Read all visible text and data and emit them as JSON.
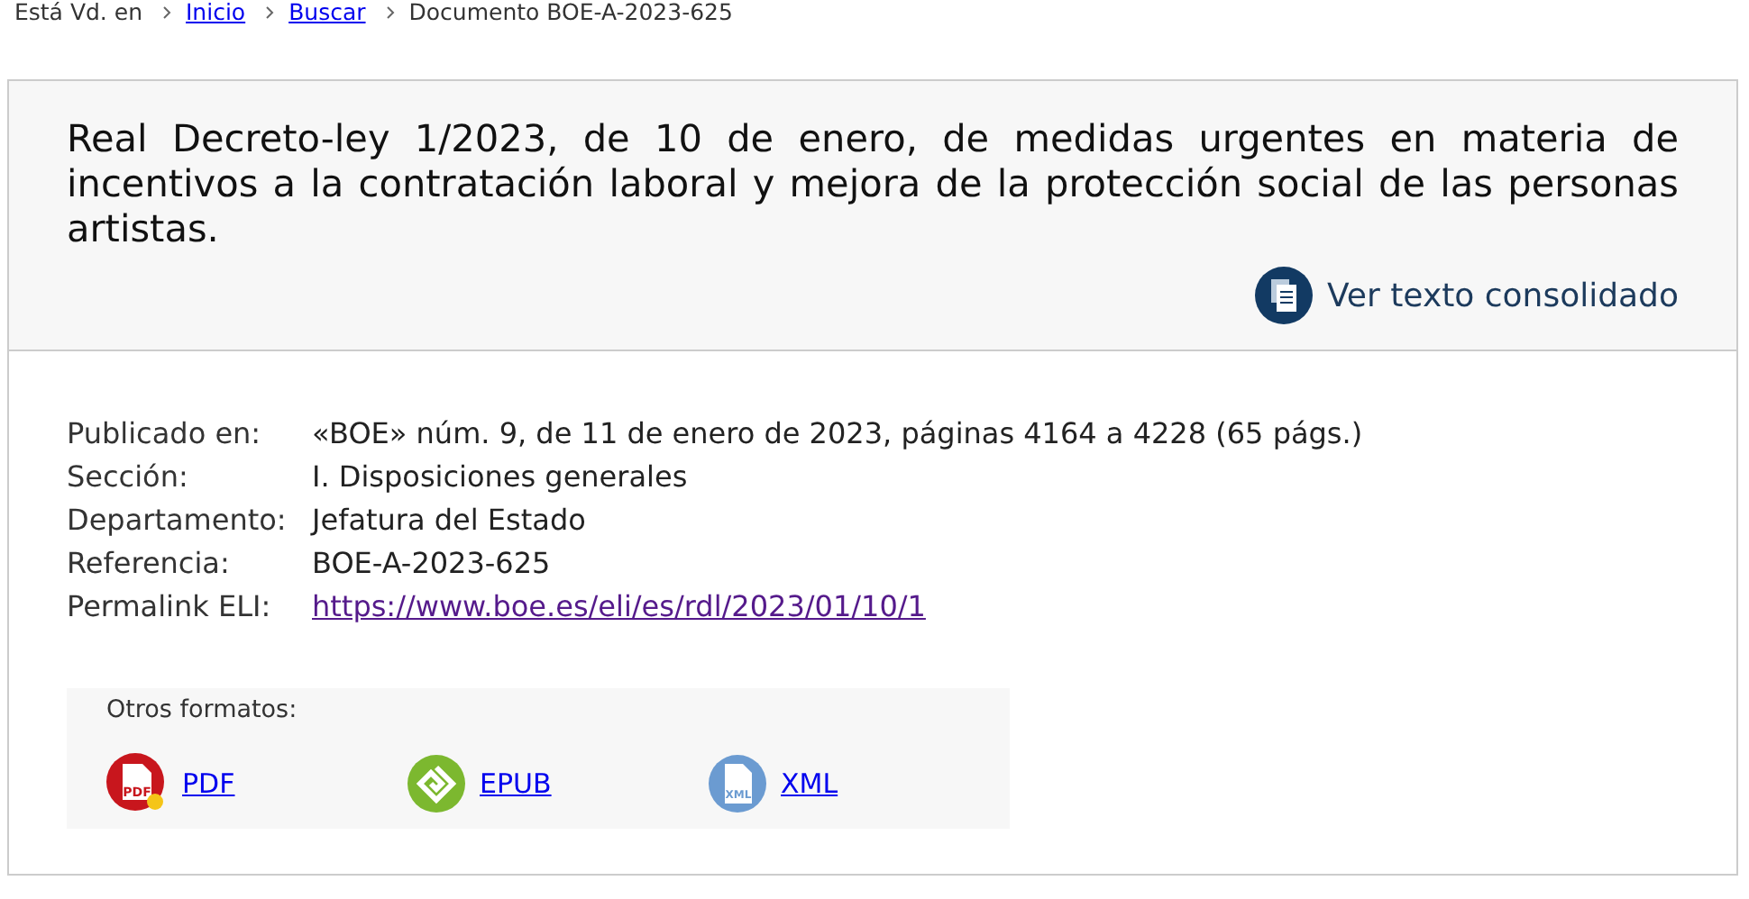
{
  "breadcrumb": {
    "label": "Está Vd. en",
    "items": [
      {
        "text": "Inicio",
        "kind": "link"
      },
      {
        "text": "Buscar",
        "kind": "link"
      },
      {
        "text": "Documento BOE-A-2023-625",
        "kind": "current"
      }
    ]
  },
  "title": "Real Decreto-ley 1/2023, de 10 de enero, de medidas urgentes en materia de incentivos a la contratación laboral y mejora de la protección social de las personas artistas.",
  "consolidated_link": "Ver texto consolidado",
  "metadata": [
    {
      "label": "Publicado en:",
      "value": "«BOE» núm. 9, de 11 de enero de 2023, páginas 4164 a 4228 (65 págs.)",
      "kind": "text"
    },
    {
      "label": "Sección:",
      "value": "I. Disposiciones generales",
      "kind": "text"
    },
    {
      "label": "Departamento:",
      "value": "Jefatura del Estado",
      "kind": "text"
    },
    {
      "label": "Referencia:",
      "value": "BOE-A-2023-625",
      "kind": "text"
    },
    {
      "label": "Permalink ELI:",
      "value": "https://www.boe.es/eli/es/rdl/2023/01/10/1",
      "kind": "link"
    }
  ],
  "formats": {
    "title": "Otros formatos:",
    "items": [
      {
        "label": "PDF",
        "kind": "pdf",
        "badge": "PDF"
      },
      {
        "label": "EPUB",
        "kind": "epub"
      },
      {
        "label": "XML",
        "kind": "xml",
        "badge": "XML"
      }
    ]
  }
}
